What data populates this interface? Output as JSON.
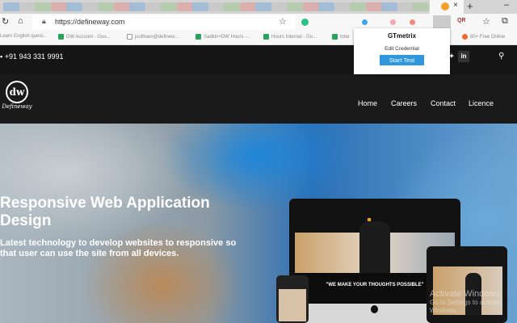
{
  "browser": {
    "url": "https://defineway.com",
    "bookmarks": [
      "Learn English quest...",
      "DW Account - Goo...",
      "jsuthoen@definew...",
      "Sadkin+DW Hours -...",
      "Hours Internal - Go...",
      "Inter",
      "80+ Free Online"
    ]
  },
  "extension_popup": {
    "title": "GTmetrix",
    "edit_link": "Edit Credential",
    "start_button": "Start Test"
  },
  "site": {
    "phone": "+91 943 331 9991",
    "logo_text": "Defineway",
    "nav": [
      "Home",
      "Careers",
      "Contact",
      "Licence"
    ],
    "hero_title": "Responsive Web Application Design",
    "hero_subtitle": "Latest technology to develop websites to responsive so that user can use the site from all devices.",
    "device_slogan": "\"WE MAKE YOUR THOUGHTS POSSIBLE\""
  },
  "watermark": {
    "line1": "Activate Windows",
    "line2": "Go to Settings to activate Windows."
  }
}
